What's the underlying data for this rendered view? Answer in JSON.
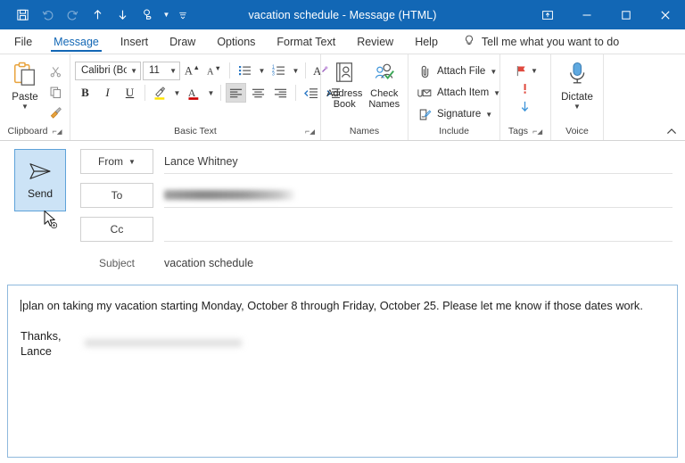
{
  "window": {
    "title": "vacation schedule  -  Message (HTML)",
    "titlebar_color": "#1267b5",
    "quick_access": [
      {
        "name": "save",
        "icon": "save-icon",
        "enabled": true
      },
      {
        "name": "undo",
        "icon": "undo-icon",
        "enabled": false
      },
      {
        "name": "redo",
        "icon": "redo-icon",
        "enabled": false
      },
      {
        "name": "previous-item",
        "icon": "arrow-up-icon",
        "enabled": true
      },
      {
        "name": "next-item",
        "icon": "arrow-down-icon",
        "enabled": true
      },
      {
        "name": "touch-mouse-mode",
        "icon": "touch-mode-icon",
        "enabled": true
      }
    ],
    "controls": {
      "ribbon_display_options": "ribbon-display-options-icon",
      "minimize": "minimize-icon",
      "maximize": "maximize-icon",
      "close": "close-icon"
    }
  },
  "tabs": [
    {
      "label": "File",
      "active": false
    },
    {
      "label": "Message",
      "active": true
    },
    {
      "label": "Insert",
      "active": false
    },
    {
      "label": "Draw",
      "active": false
    },
    {
      "label": "Options",
      "active": false
    },
    {
      "label": "Format Text",
      "active": false
    },
    {
      "label": "Review",
      "active": false
    },
    {
      "label": "Help",
      "active": false
    }
  ],
  "tell_me": {
    "icon": "lightbulb-icon",
    "placeholder": "Tell me what you want to do"
  },
  "ribbon": {
    "groups": [
      {
        "name": "clipboard",
        "label": "Clipboard",
        "has_launcher": true,
        "paste": {
          "label": "Paste",
          "icon": "paste-icon",
          "dropdown": true
        },
        "buttons": [
          {
            "label": "Cut",
            "icon": "scissors-icon"
          },
          {
            "label": "Copy",
            "icon": "copy-icon"
          },
          {
            "label": "Format Painter",
            "icon": "format-painter-icon"
          }
        ]
      },
      {
        "name": "basic-text",
        "label": "Basic Text",
        "has_launcher": true,
        "font_name": "Calibri (Bo",
        "font_size": "11",
        "row1": [
          {
            "label": "Grow Font",
            "icon": "grow-font-icon"
          },
          {
            "label": "Shrink Font",
            "icon": "shrink-font-icon"
          },
          {
            "label": "Bullets",
            "icon": "bullets-icon"
          },
          {
            "label": "Numbering",
            "icon": "numbering-icon"
          },
          {
            "label": "Clear All Formatting",
            "icon": "clear-formatting-icon"
          }
        ],
        "row2": [
          {
            "label": "Bold",
            "icon": "bold-icon"
          },
          {
            "label": "Italic",
            "icon": "italic-icon"
          },
          {
            "label": "Underline",
            "icon": "underline-icon"
          },
          {
            "label": "Text Highlight Color",
            "icon": "highlight-icon",
            "color": "#ffe400"
          },
          {
            "label": "Font Color",
            "icon": "font-color-icon",
            "color": "#cc0000"
          },
          {
            "label": "Align Left",
            "icon": "align-left-icon",
            "selected": true
          },
          {
            "label": "Center",
            "icon": "align-center-icon"
          },
          {
            "label": "Align Right",
            "icon": "align-right-icon"
          },
          {
            "label": "Decrease Indent",
            "icon": "decrease-indent-icon"
          },
          {
            "label": "Increase Indent",
            "icon": "increase-indent-icon"
          }
        ]
      },
      {
        "name": "names",
        "label": "Names",
        "has_launcher": false,
        "buttons": [
          {
            "label": "Address\nBook",
            "line1": "Address",
            "line2": "Book",
            "icon": "address-book-icon"
          },
          {
            "label": "Check\nNames",
            "line1": "Check",
            "line2": "Names",
            "icon": "check-names-icon"
          }
        ]
      },
      {
        "name": "include",
        "label": "Include",
        "has_launcher": false,
        "buttons": [
          {
            "label": "Attach File",
            "icon": "paperclip-icon",
            "dropdown": true
          },
          {
            "label": "Attach Item",
            "icon": "attach-item-icon",
            "dropdown": true
          },
          {
            "label": "Signature",
            "icon": "signature-icon",
            "dropdown": true
          }
        ]
      },
      {
        "name": "tags",
        "label": "Tags",
        "has_launcher": true,
        "buttons": [
          {
            "label": "Follow Up",
            "icon": "flag-icon",
            "color": "#e04a3f",
            "dropdown": true
          },
          {
            "label": "High Importance",
            "icon": "high-importance-icon",
            "color": "#e04a3f"
          },
          {
            "label": "Low Importance",
            "icon": "low-importance-icon",
            "color": "#3d94d9"
          }
        ]
      },
      {
        "name": "voice",
        "label": "Voice",
        "has_launcher": false,
        "dictate": {
          "label": "Dictate",
          "icon": "microphone-icon",
          "dropdown": true
        }
      }
    ],
    "collapse_icon": "chevron-up-icon"
  },
  "compose": {
    "send_button": {
      "label": "Send",
      "icon": "send-icon",
      "hovered": true
    },
    "cursor_icon": "mouse-pointer-icon",
    "from": {
      "label": "From",
      "value": "Lance Whitney",
      "dropdown": true
    },
    "to": {
      "label": "To",
      "value": "",
      "redacted": true
    },
    "cc": {
      "label": "Cc",
      "value": ""
    },
    "subject": {
      "label": "Subject",
      "value": "vacation schedule"
    },
    "body": {
      "paragraph1": "plan on taking my vacation starting Monday, October 8 through Friday, October 25. Please let me know if those dates work.",
      "paragraph2": "Thanks,",
      "paragraph3": "Lance"
    }
  }
}
